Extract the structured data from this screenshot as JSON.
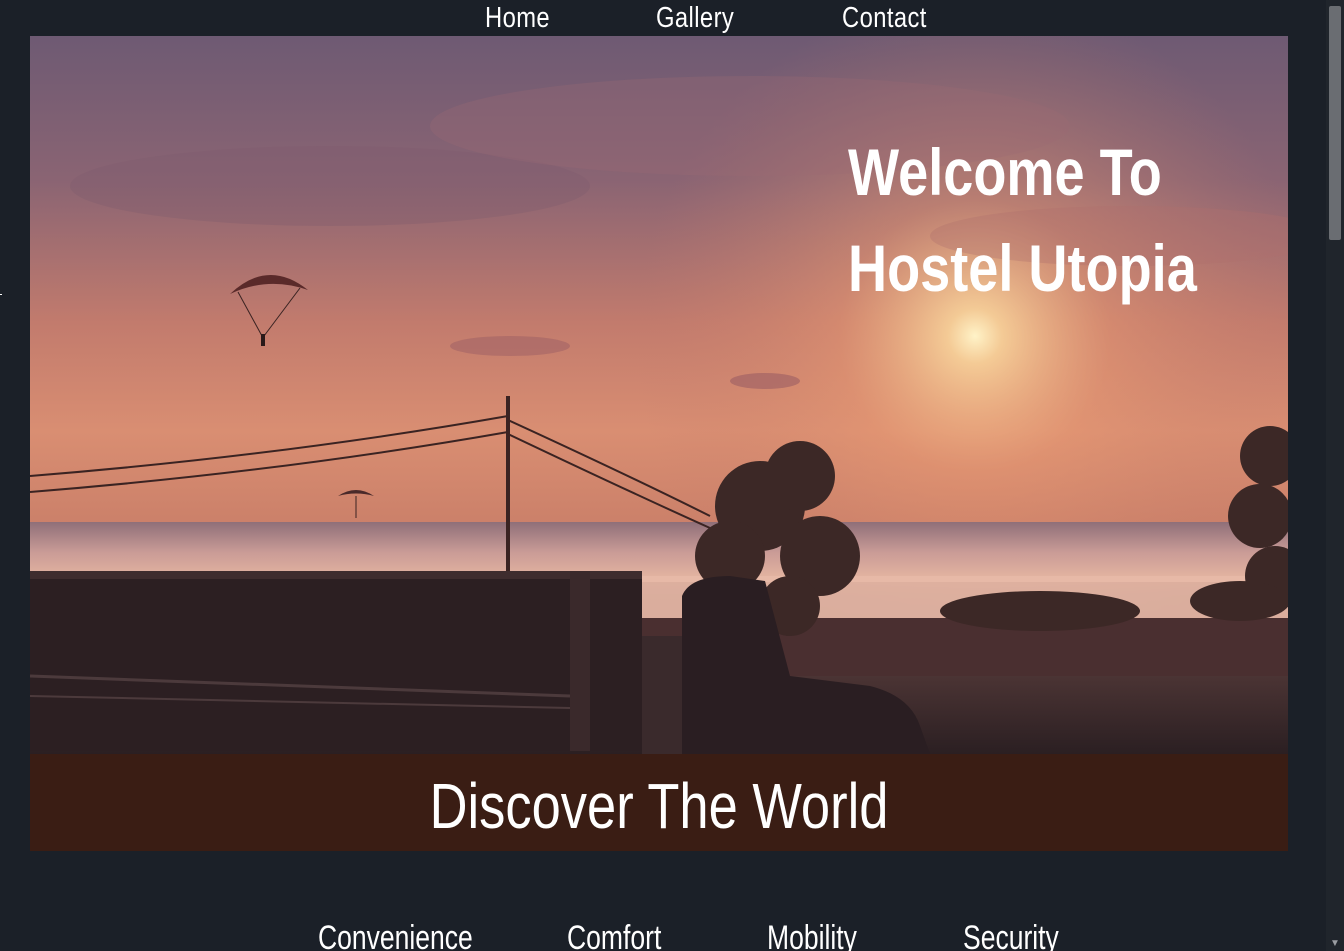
{
  "nav": {
    "home": "Home",
    "gallery": "Gallery",
    "contact": "Contact"
  },
  "hero": {
    "title": "Welcome To Hostel Utopia"
  },
  "banner": {
    "text": "Discover The World"
  },
  "features": {
    "items": [
      "Convenience",
      "Comfort",
      "Mobility",
      "Security"
    ]
  },
  "colors": {
    "page_bg": "#1b2028",
    "banner_bg": "#3a1d14",
    "text": "#ffffff"
  }
}
